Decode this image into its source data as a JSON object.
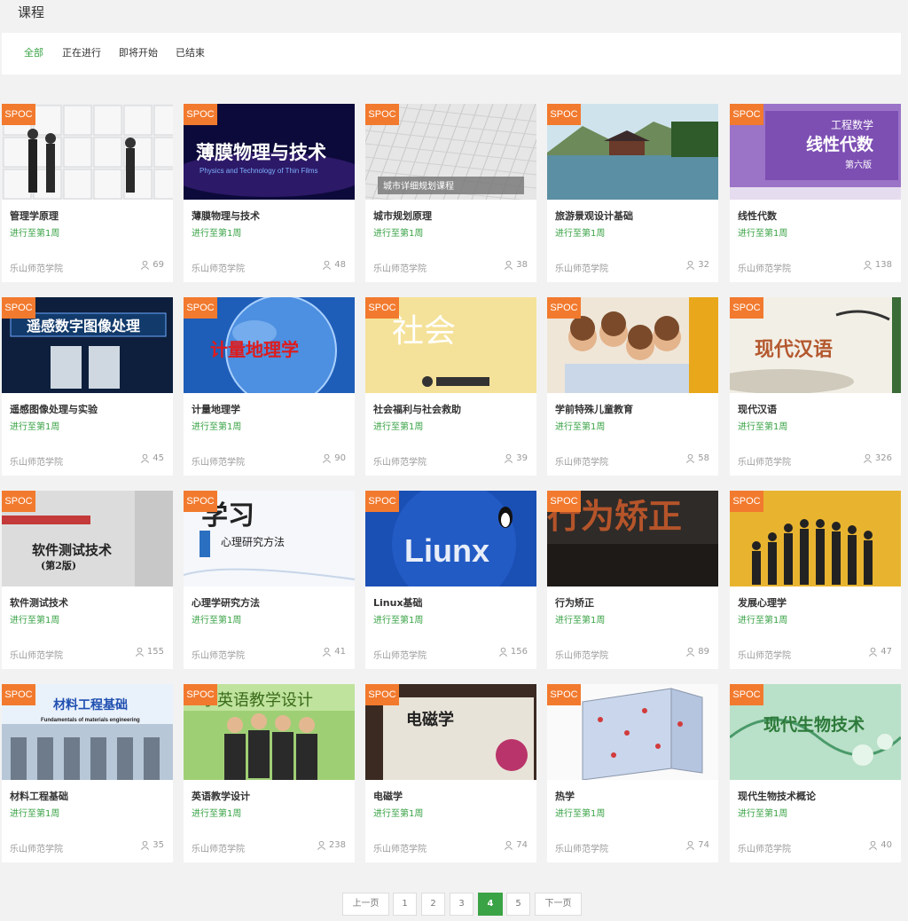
{
  "page": {
    "title": "课程"
  },
  "filters": [
    "全部",
    "正在进行",
    "即将开始",
    "已结束"
  ],
  "badge": "SPOC",
  "courses": [
    {
      "title": "管理学原理",
      "progress": "进行至第1周",
      "school": "乐山师范学院",
      "count": "69",
      "thumb": "puzzle-people",
      "cover_text": ""
    },
    {
      "title": "薄膜物理与技术",
      "progress": "进行至第1周",
      "school": "乐山师范学院",
      "count": "48",
      "thumb": "thin-films",
      "cover_text": "薄膜物理与技术",
      "cover_sub": "Physics and Technology of Thin Films"
    },
    {
      "title": "城市规划原理",
      "progress": "进行至第1周",
      "school": "乐山师范学院",
      "count": "38",
      "thumb": "city-map",
      "cover_text": "城市详细规划课程"
    },
    {
      "title": "旅游景观设计基础",
      "progress": "进行至第1周",
      "school": "乐山师范学院",
      "count": "32",
      "thumb": "landscape",
      "cover_text": ""
    },
    {
      "title": "线性代数",
      "progress": "进行至第1周",
      "school": "乐山师范学院",
      "count": "138",
      "thumb": "linear-algebra",
      "cover_text": "线性代数",
      "cover_top": "工程数学",
      "cover_sub": "第六版"
    },
    {
      "title": "遥感图像处理与实验",
      "progress": "进行至第1周",
      "school": "乐山师范学院",
      "count": "45",
      "thumb": "remote-sensing",
      "cover_text": "遥感数字图像处理"
    },
    {
      "title": "计量地理学",
      "progress": "进行至第1周",
      "school": "乐山师范学院",
      "count": "90",
      "thumb": "globe",
      "cover_text": "计量地理学"
    },
    {
      "title": "社会福利与社会救助",
      "progress": "进行至第1周",
      "school": "乐山师范学院",
      "count": "39",
      "thumb": "social-welfare",
      "cover_text": "社会"
    },
    {
      "title": "学前特殊儿童教育",
      "progress": "进行至第1周",
      "school": "乐山师范学院",
      "count": "58",
      "thumb": "children",
      "cover_text": ""
    },
    {
      "title": "现代汉语",
      "progress": "进行至第1周",
      "school": "乐山师范学院",
      "count": "326",
      "thumb": "chinese-ink",
      "cover_text": "现代汉语"
    },
    {
      "title": "软件测试技术",
      "progress": "进行至第1周",
      "school": "乐山师范学院",
      "count": "155",
      "thumb": "software-testing",
      "cover_text": "软件测试技术",
      "cover_sub": "(第2版)"
    },
    {
      "title": "心理学研究方法",
      "progress": "进行至第1周",
      "school": "乐山师范学院",
      "count": "41",
      "thumb": "psychology",
      "cover_text": "学习",
      "cover_sub": "心理研究方法"
    },
    {
      "title": "Linux基础",
      "progress": "进行至第1周",
      "school": "乐山师范学院",
      "count": "156",
      "thumb": "linux",
      "cover_text": "Liunx"
    },
    {
      "title": "行为矫正",
      "progress": "进行至第1周",
      "school": "乐山师范学院",
      "count": "89",
      "thumb": "behavior",
      "cover_text": "行为矫正"
    },
    {
      "title": "发展心理学",
      "progress": "进行至第1周",
      "school": "乐山师范学院",
      "count": "47",
      "thumb": "silhouettes",
      "cover_text": ""
    },
    {
      "title": "材料工程基础",
      "progress": "进行至第1周",
      "school": "乐山师范学院",
      "count": "35",
      "thumb": "materials",
      "cover_text": "材料工程基础",
      "cover_sub": "Fundamentals of materials engineering"
    },
    {
      "title": "英语教学设计",
      "progress": "进行至第1周",
      "school": "乐山师范学院",
      "count": "238",
      "thumb": "teachers",
      "cover_text": "学英语教学设计"
    },
    {
      "title": "电磁学",
      "progress": "进行至第1周",
      "school": "乐山师范学院",
      "count": "74",
      "thumb": "electromagnetism",
      "cover_text": "电磁学"
    },
    {
      "title": "热学",
      "progress": "进行至第1周",
      "school": "乐山师范学院",
      "count": "74",
      "thumb": "cube-molecules",
      "cover_text": ""
    },
    {
      "title": "现代生物技术概论",
      "progress": "进行至第1周",
      "school": "乐山师范学院",
      "count": "40",
      "thumb": "biotech",
      "cover_text": "现代生物技术"
    }
  ],
  "pagination": {
    "prev": "上一页",
    "pages": [
      "1",
      "2",
      "3",
      "4",
      "5"
    ],
    "current": "4",
    "next": "下一页"
  },
  "colors": {
    "accent": "#3aa346",
    "badge": "#f27a2e"
  }
}
